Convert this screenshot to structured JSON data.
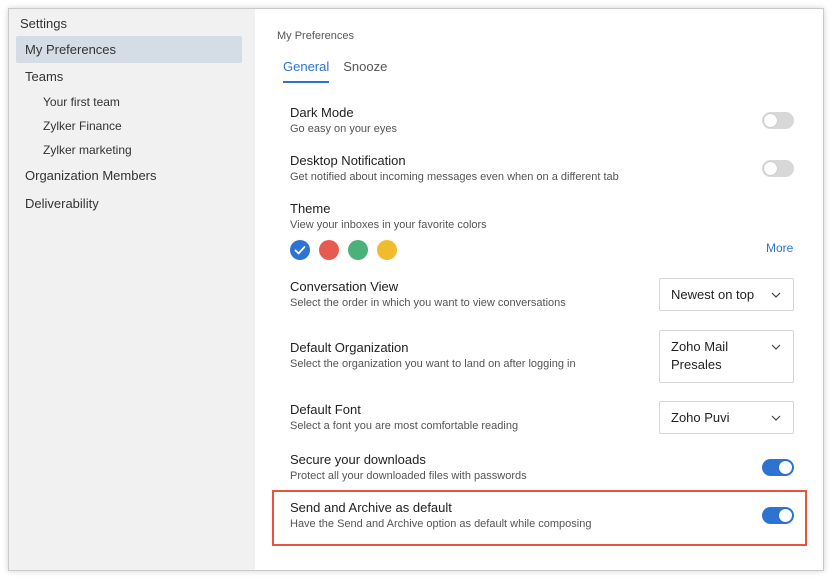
{
  "sidebar": {
    "title": "Settings",
    "items": [
      {
        "label": "My Preferences"
      },
      {
        "label": "Teams"
      },
      {
        "label": "Organization Members"
      },
      {
        "label": "Deliverability"
      }
    ],
    "teams": [
      {
        "label": "Your first team"
      },
      {
        "label": "Zylker Finance"
      },
      {
        "label": "Zylker marketing"
      }
    ]
  },
  "main": {
    "breadcrumb": "My Preferences",
    "tabs": [
      {
        "label": "General",
        "active": true
      },
      {
        "label": "Snooze",
        "active": false
      }
    ],
    "settings": {
      "dark_mode": {
        "title": "Dark Mode",
        "desc": "Go easy on your eyes",
        "enabled": false
      },
      "desktop_notification": {
        "title": "Desktop Notification",
        "desc": "Get notified about incoming messages even when on a different tab",
        "enabled": false
      },
      "theme": {
        "title": "Theme",
        "desc": "View your inboxes in your favorite colors",
        "more": "More",
        "colors": [
          "#2c73d2",
          "#e85a4f",
          "#4cb07a",
          "#f0bb2c"
        ],
        "selected": 0
      },
      "conversation_view": {
        "title": "Conversation View",
        "desc": "Select the order in which you want to view conversations",
        "value": "Newest on top"
      },
      "default_org": {
        "title": "Default Organization",
        "desc": "Select the organization you want to land on after logging in",
        "value": "Zoho Mail Presales"
      },
      "default_font": {
        "title": "Default Font",
        "desc": "Select a font you are most comfortable reading",
        "value": "Zoho Puvi"
      },
      "secure_downloads": {
        "title": "Secure your downloads",
        "desc": "Protect all your downloaded files with passwords",
        "enabled": true
      },
      "send_archive": {
        "title": "Send and Archive as default",
        "desc": "Have the Send and Archive option as default while composing",
        "enabled": true
      }
    }
  },
  "colors": {
    "accent": "#2c73d2",
    "highlight": "#e8553f",
    "sidebar_bg": "#f1f1f1",
    "active_item_bg": "#d4dde6"
  }
}
